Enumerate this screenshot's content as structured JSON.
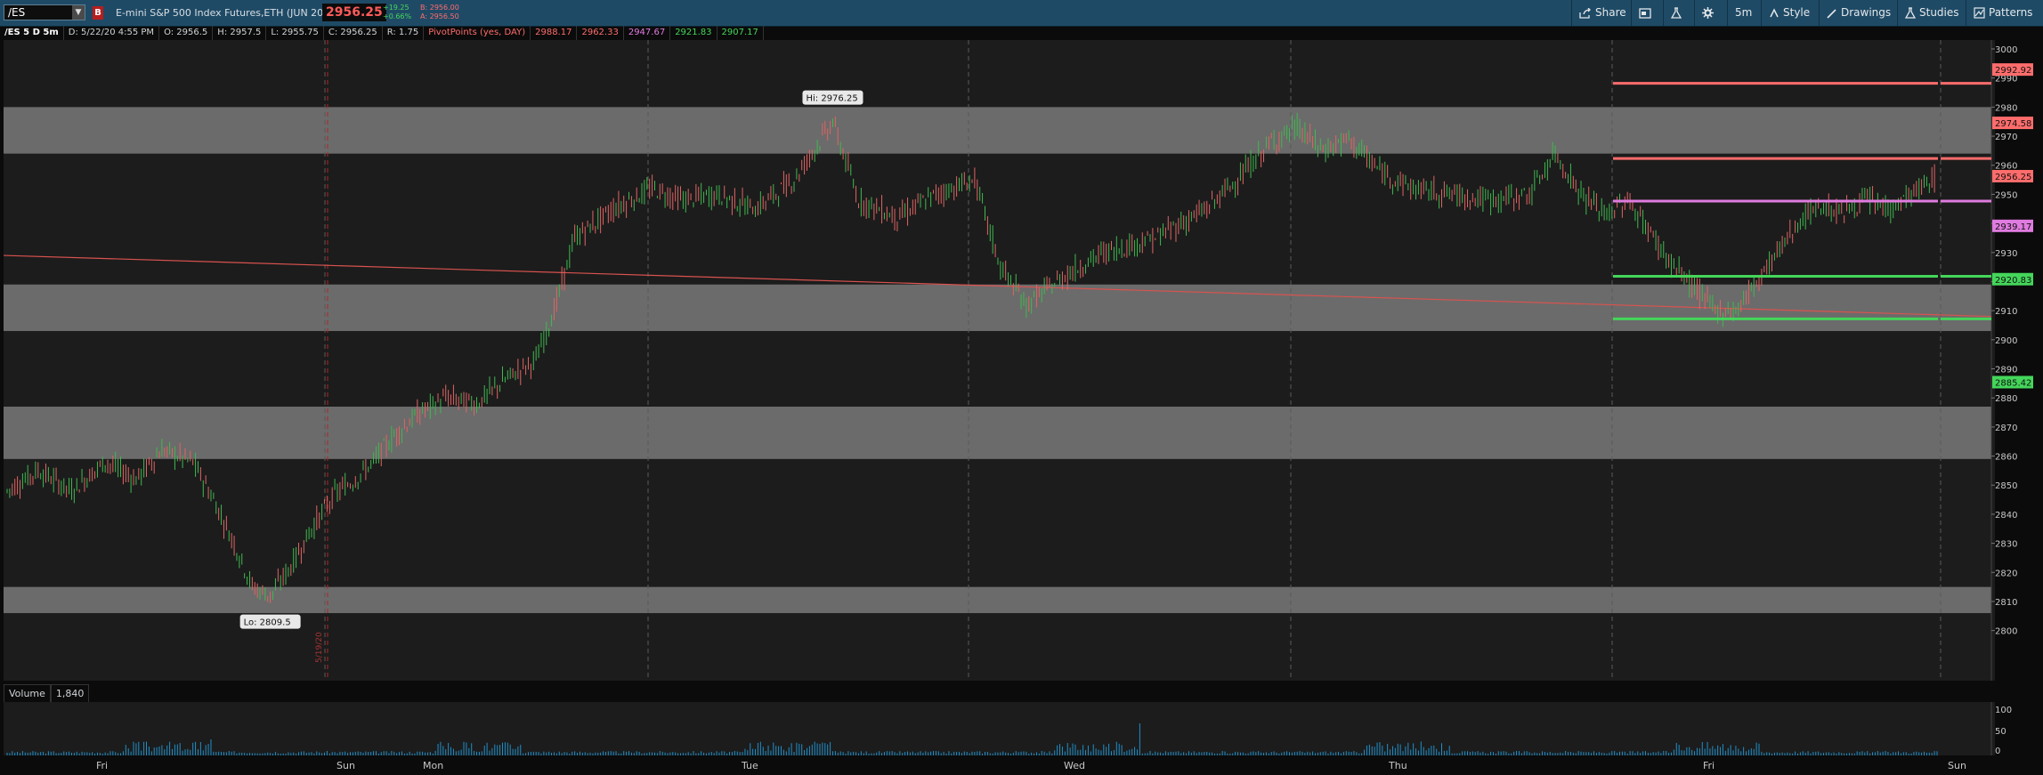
{
  "header": {
    "symbol": "/ES",
    "title": "E-mini S&P 500 Index Futures,ETH (JUN 20)",
    "last_price": "2956.25",
    "change_abs": "+19.25",
    "change_pct": "+0.66%",
    "bid": "B: 2956.00",
    "ask": "A: 2956.50",
    "toolbar": {
      "share": "Share",
      "interval": "5m",
      "style": "Style",
      "drawings": "Drawings",
      "studies": "Studies",
      "patterns": "Patterns"
    }
  },
  "info": {
    "timeframe": "/ES 5 D 5m",
    "date": "D: 5/22/20 4:55 PM",
    "open": "O: 2956.5",
    "high": "H: 2957.5",
    "low": "L: 2955.75",
    "close": "C: 2956.25",
    "range": "R: 1.75",
    "pivot_label": "PivotPoints (yes, DAY)",
    "pivot_values": [
      "2988.17",
      "2962.33",
      "2947.67",
      "2921.83",
      "2907.17"
    ],
    "pivot_colors": [
      "#ff6c6c",
      "#ff6c6c",
      "#e07be0",
      "#44d65a",
      "#44d65a"
    ]
  },
  "chart_data": {
    "type": "candlestick",
    "x_labels": [
      "Fri",
      "Sun",
      "Mon",
      "Tue",
      "Wed",
      "Thu",
      "Fri",
      "Sun"
    ],
    "ylim": [
      2795,
      3000
    ],
    "y_ticks": [
      3000,
      2990,
      2980,
      2970,
      2960,
      2950,
      2940,
      2930,
      2920,
      2910,
      2900,
      2890,
      2880,
      2870,
      2860,
      2850,
      2840,
      2830,
      2820,
      2810,
      2800
    ],
    "y_tick_labels": [
      "3000",
      "2990",
      "2980",
      "2970",
      "2960",
      "2950",
      "2940",
      "2930",
      "2920",
      "2910",
      "2900",
      "2890",
      "2880",
      "2870",
      "2860",
      "2850",
      "2840",
      "2830",
      "2820",
      "2810",
      "2800"
    ],
    "zones": [
      [
        2964,
        2980
      ],
      [
        2903,
        2919
      ],
      [
        2859,
        2877
      ],
      [
        2806,
        2815
      ]
    ],
    "price_path": [
      [
        0,
        2848
      ],
      [
        12,
        2855
      ],
      [
        25,
        2848
      ],
      [
        38,
        2858
      ],
      [
        50,
        2852
      ],
      [
        60,
        2862
      ],
      [
        72,
        2858
      ],
      [
        80,
        2845
      ],
      [
        88,
        2830
      ],
      [
        95,
        2815
      ],
      [
        102,
        2812
      ],
      [
        110,
        2822
      ],
      [
        118,
        2835
      ],
      [
        127,
        2847
      ],
      [
        135,
        2852
      ],
      [
        142,
        2858
      ],
      [
        150,
        2867
      ],
      [
        160,
        2875
      ],
      [
        170,
        2880
      ],
      [
        182,
        2878
      ],
      [
        194,
        2887
      ],
      [
        205,
        2893
      ],
      [
        212,
        2910
      ],
      [
        220,
        2935
      ],
      [
        235,
        2945
      ],
      [
        250,
        2952
      ],
      [
        262,
        2948
      ],
      [
        275,
        2950
      ],
      [
        290,
        2945
      ],
      [
        305,
        2955
      ],
      [
        320,
        2975
      ],
      [
        330,
        2948
      ],
      [
        345,
        2942
      ],
      [
        360,
        2950
      ],
      [
        375,
        2955
      ],
      [
        385,
        2925
      ],
      [
        395,
        2912
      ],
      [
        410,
        2922
      ],
      [
        425,
        2930
      ],
      [
        445,
        2935
      ],
      [
        465,
        2945
      ],
      [
        480,
        2958
      ],
      [
        490,
        2968
      ],
      [
        500,
        2973
      ],
      [
        510,
        2965
      ],
      [
        520,
        2969
      ],
      [
        532,
        2958
      ],
      [
        545,
        2952
      ],
      [
        560,
        2950
      ],
      [
        575,
        2948
      ],
      [
        590,
        2950
      ],
      [
        600,
        2964
      ],
      [
        610,
        2950
      ],
      [
        620,
        2943
      ],
      [
        628,
        2948
      ],
      [
        636,
        2938
      ],
      [
        645,
        2926
      ],
      [
        655,
        2917
      ],
      [
        662,
        2910
      ],
      [
        670,
        2910
      ],
      [
        678,
        2920
      ],
      [
        686,
        2930
      ],
      [
        694,
        2940
      ],
      [
        702,
        2946
      ],
      [
        712,
        2944
      ],
      [
        720,
        2948
      ],
      [
        730,
        2945
      ],
      [
        740,
        2951
      ],
      [
        748,
        2956
      ]
    ],
    "trendline": [
      [
        0,
        2929
      ],
      [
        1.0,
        2908
      ]
    ],
    "pivots": [
      {
        "value": 2988.17,
        "color": "#ff6c6c"
      },
      {
        "value": 2962.33,
        "color": "#ff6c6c"
      },
      {
        "value": 2947.67,
        "color": "#e07be0"
      },
      {
        "value": 2921.83,
        "color": "#44d65a"
      },
      {
        "value": 2907.17,
        "color": "#44d65a"
      }
    ],
    "price_tags": [
      {
        "label": "2992.92",
        "value": 2992.92,
        "color": "#ff6c6c"
      },
      {
        "label": "2974.58",
        "value": 2974.58,
        "color": "#ff6c6c"
      },
      {
        "label": "2956.25",
        "value": 2956.25,
        "color": "#ff6c6c"
      },
      {
        "label": "2939.17",
        "value": 2939.17,
        "color": "#e07be0"
      },
      {
        "label": "2920.83",
        "value": 2920.83,
        "color": "#44d65a"
      },
      {
        "label": "2885.42",
        "value": 2885.42,
        "color": "#44d65a"
      }
    ],
    "annotations": [
      {
        "label": "Hi: 2976.25",
        "value": 2976.25
      },
      {
        "label": "Lo: 2809.5",
        "value": 2809.5
      }
    ],
    "session_label": "5/19/20"
  },
  "volume": {
    "label": "Volume",
    "value": "1,840",
    "y_ticks": [
      "100",
      "50",
      "0"
    ],
    "spikes": [
      30,
      20,
      25,
      60,
      18,
      22,
      40,
      15,
      20,
      18,
      22,
      55
    ]
  }
}
